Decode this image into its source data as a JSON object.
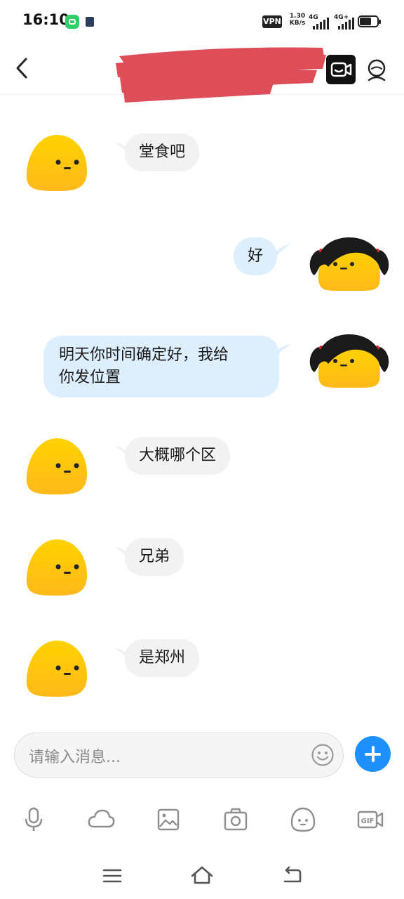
{
  "status_bar": {
    "time": "16:10",
    "vpn": "VPN",
    "speed_value": "1.30",
    "speed_unit": "KB/s",
    "sim1": "4G",
    "sim2": "4G+"
  },
  "header": {
    "contact_name_redacted": true,
    "back_icon": "chevron-left-icon",
    "video_icon": "video-call-icon",
    "profile_icon": "user-profile-icon"
  },
  "messages": [
    {
      "side": "left",
      "text": "堂食吧"
    },
    {
      "side": "right",
      "text": "好"
    },
    {
      "side": "right",
      "line1": "明天你时间确定好，我给",
      "line2": "你发位置"
    },
    {
      "side": "left",
      "text": "大概哪个区"
    },
    {
      "side": "left",
      "text": "兄弟"
    },
    {
      "side": "left",
      "text": "是郑州"
    }
  ],
  "input": {
    "placeholder": "请输入消息..."
  },
  "toolbar": [
    "microphone-icon",
    "cloud-icon",
    "image-icon",
    "camera-icon",
    "emoji-icon",
    "gif-icon"
  ],
  "colors": {
    "accent": "#1e90ff",
    "bubble_left": "#f2f2f2",
    "bubble_right": "#ddeefc",
    "avatar_yellow": "#ffc800",
    "redaction": "#dd4e58"
  }
}
